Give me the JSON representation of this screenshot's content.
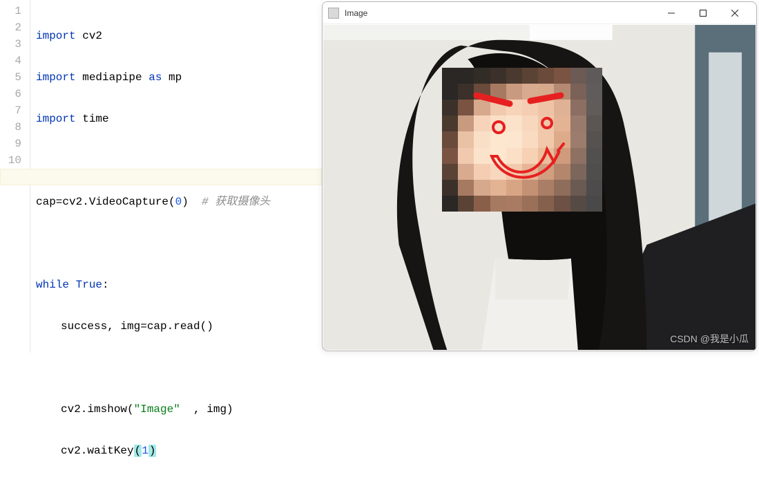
{
  "editor": {
    "line_count": 11,
    "current_line": 11,
    "lines": {
      "l1_kw": "import",
      "l1_mod": " cv2",
      "l2_kw": "import",
      "l2_mod": " mediapipe ",
      "l2_as": "as",
      "l2_alias": " mp",
      "l3_kw": "import",
      "l3_mod": " time",
      "l4": "",
      "l5_a": "cap=cv2.VideoCapture(",
      "l5_num": "0",
      "l5_b": ")  ",
      "l5_cmt": "# 获取摄像头",
      "l6": "",
      "l7_kw1": "while",
      "l7_sp": " ",
      "l7_kw2": "True",
      "l7_colon": ":",
      "l8": "success, img=cap.read()",
      "l9": "",
      "l10_a": "cv2.imshow(",
      "l10_str": "\"Image\"",
      "l10_b": "  , img)",
      "l11_a": "cv2.waitKey",
      "l11_p1": "(",
      "l11_num": "1",
      "l11_p2": ")"
    }
  },
  "window": {
    "title": "Image",
    "minimize_label": "Minimize",
    "maximize_label": "Maximize",
    "close_label": "Close"
  },
  "watermark": "CSDN @我是小瓜"
}
